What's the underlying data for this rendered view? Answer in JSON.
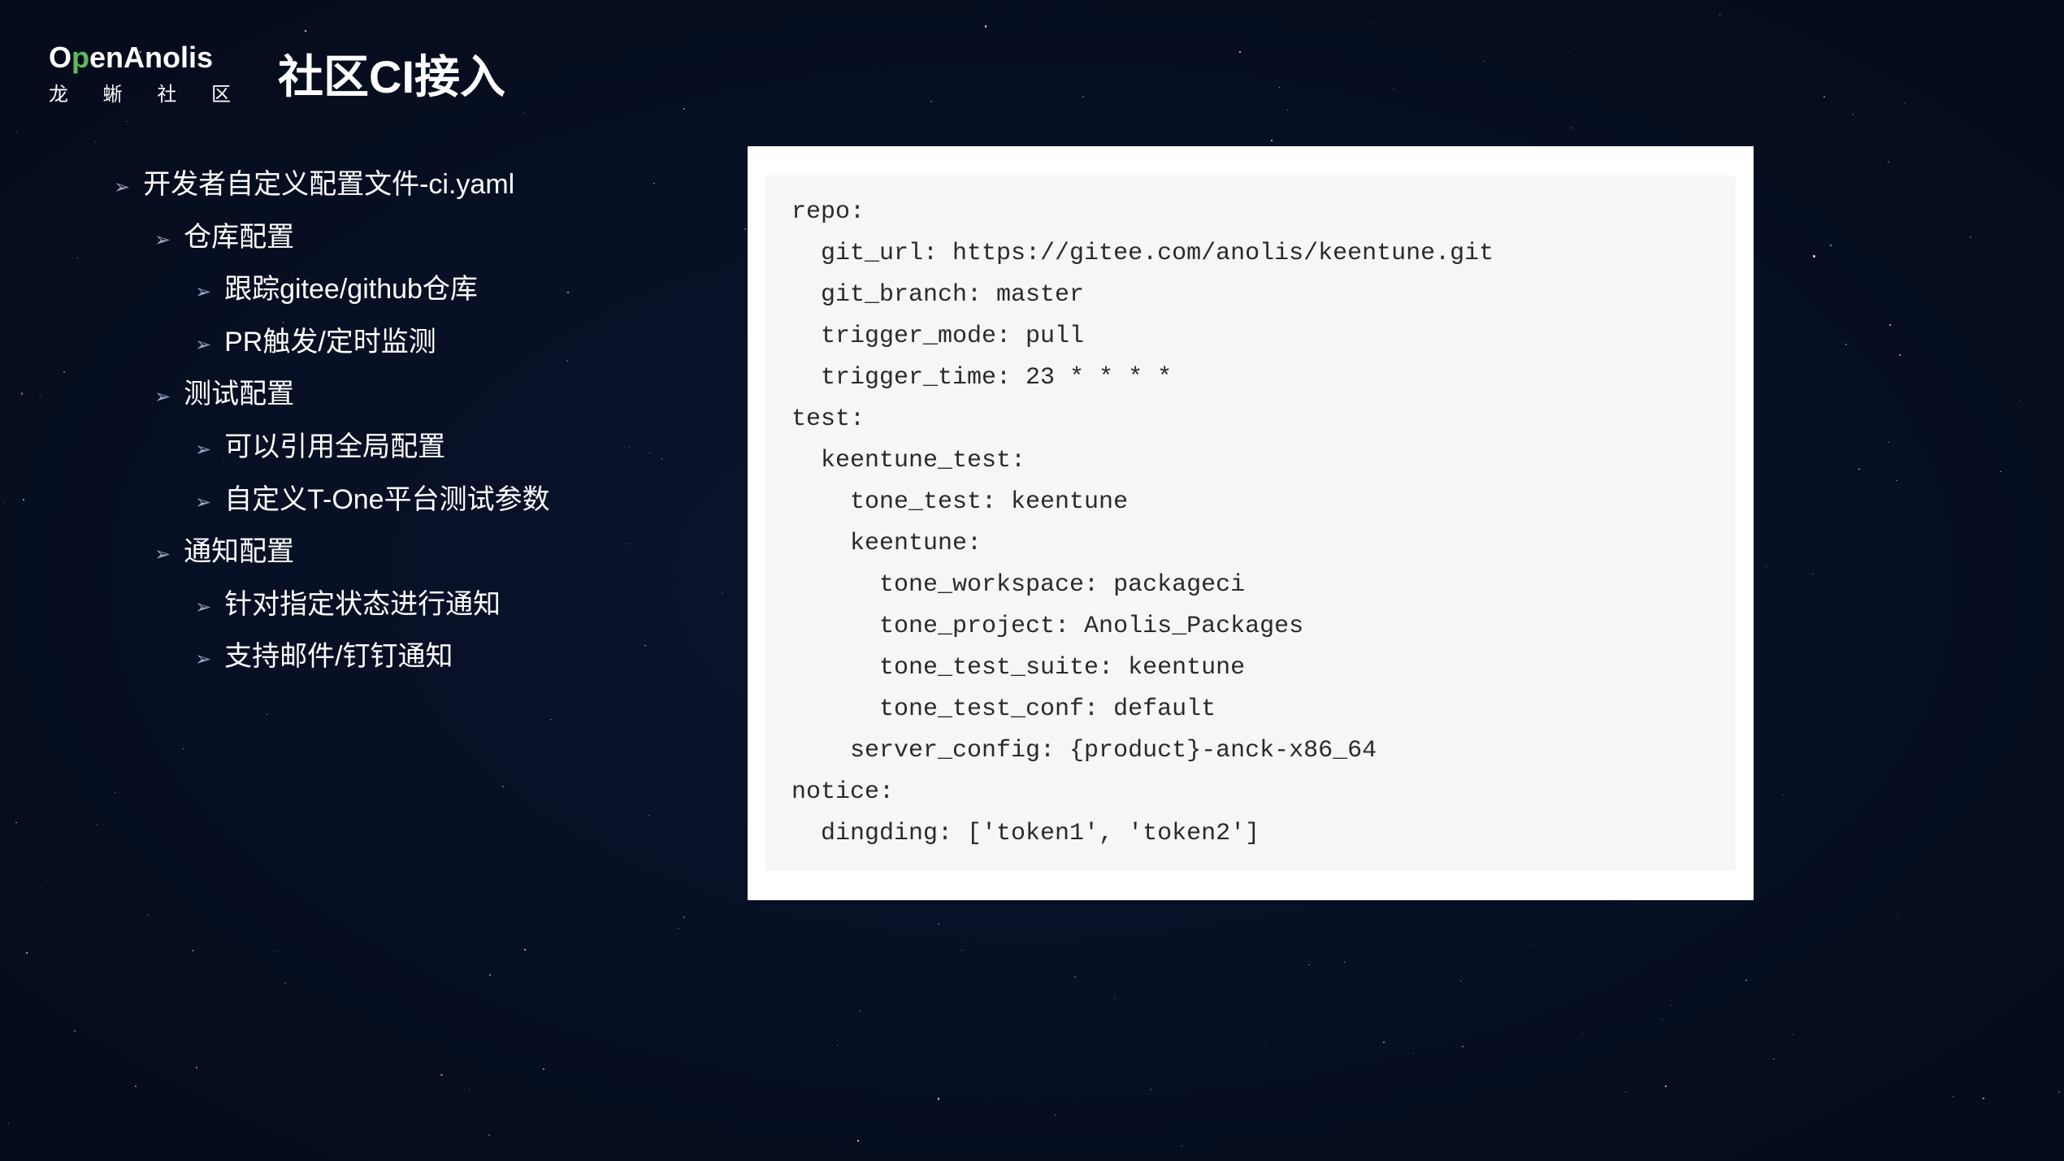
{
  "logo": {
    "main_prefix": "O",
    "main_p": "p",
    "main_rest": "enAnolis",
    "sub": "龙 蜥 社 区"
  },
  "title": "社区CI接入",
  "bullets": {
    "l1_0": "开发者自定义配置文件-ci.yaml",
    "l2_0": "仓库配置",
    "l3_0": "跟踪gitee/github仓库",
    "l3_1": "PR触发/定时监测",
    "l2_1": "测试配置",
    "l3_2": "可以引用全局配置",
    "l3_3": "自定义T-One平台测试参数",
    "l2_2": "通知配置",
    "l3_4": "针对指定状态进行通知",
    "l3_5": "支持邮件/钉钉通知"
  },
  "code": "repo:\n  git_url: https://gitee.com/anolis/keentune.git\n  git_branch: master\n  trigger_mode: pull\n  trigger_time: 23 * * * *\ntest:\n  keentune_test:\n    tone_test: keentune\n    keentune:\n      tone_workspace: packageci\n      tone_project: Anolis_Packages\n      tone_test_suite: keentune\n      tone_test_conf: default\n    server_config: {product}-anck-x86_64\nnotice:\n  dingding: ['token1', 'token2']"
}
